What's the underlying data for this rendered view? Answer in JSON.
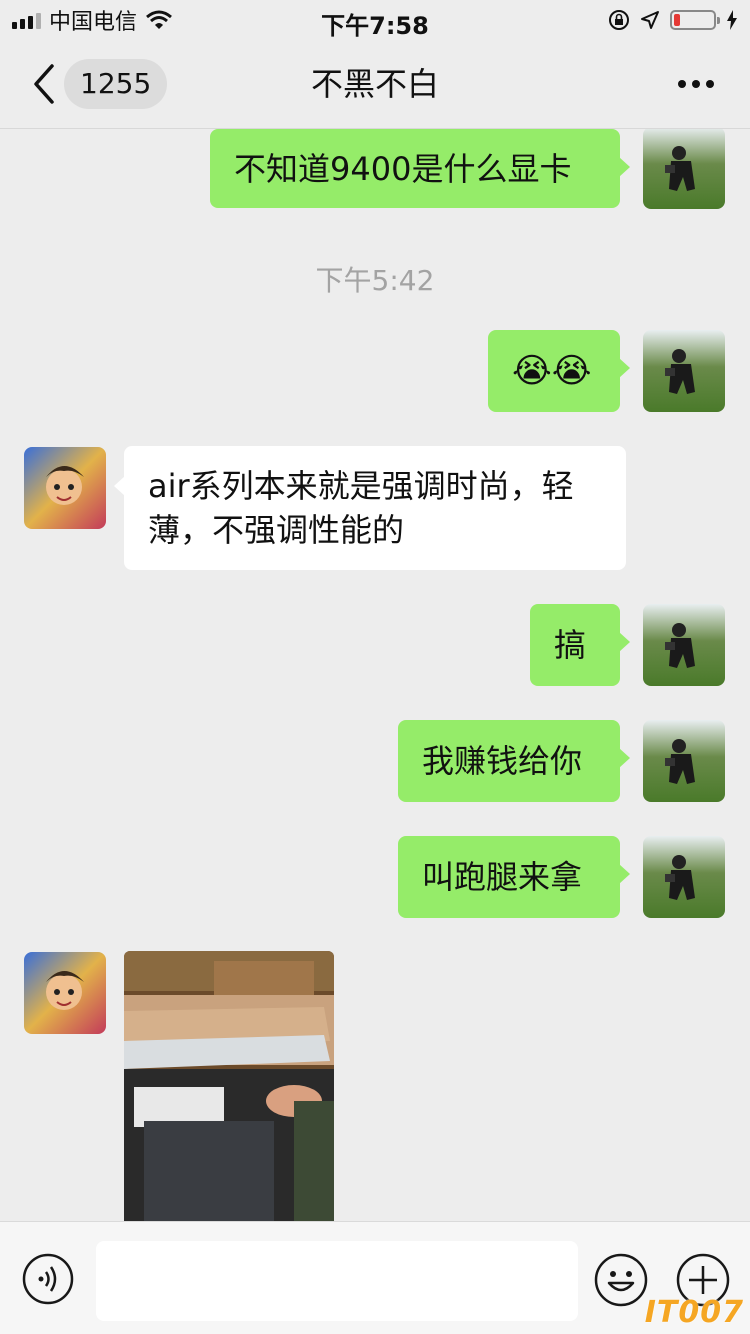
{
  "status_bar": {
    "carrier": "中国电信",
    "time": "下午7:58"
  },
  "nav": {
    "unread_count": "1255",
    "title": "不黑不白"
  },
  "messages": [
    {
      "side": "me",
      "text": "不知道9400是什么显卡"
    },
    {
      "type": "timestamp",
      "text": "下午5:42"
    },
    {
      "side": "me",
      "emoji": "😭😭"
    },
    {
      "side": "them",
      "text": "air系列本来就是强调时尚，轻薄，不强调性能的"
    },
    {
      "side": "me",
      "text": "搞"
    },
    {
      "side": "me",
      "text": "我赚钱给你"
    },
    {
      "side": "me",
      "text": "叫跑腿来拿"
    },
    {
      "side": "them",
      "type": "image"
    }
  ],
  "input": {
    "placeholder": ""
  },
  "watermark": "IT007",
  "colors": {
    "my_bubble": "#95ec69",
    "their_bubble": "#ffffff",
    "background": "#ededed",
    "battery_low": "#e53935"
  },
  "status": {
    "battery_level": 0.15
  }
}
